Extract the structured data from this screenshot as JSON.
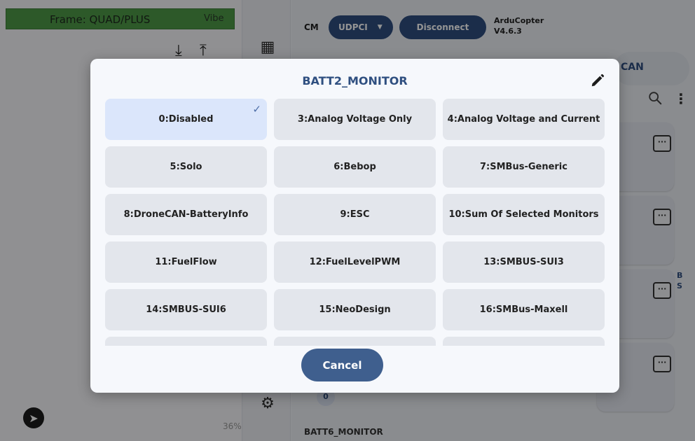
{
  "left": {
    "frame_label": "Frame: QUAD/PLUS",
    "vibe_label": "Vibe",
    "percent_text": "36%"
  },
  "connection": {
    "cm_label": "CM",
    "link_type": "UDPCI",
    "disconnect_label": "Disconnect",
    "vehicle_name": "ArduCopter",
    "vehicle_version": "V4.6.3"
  },
  "tabs": {
    "can_label": "CAN"
  },
  "params": {
    "side_letters": [
      "B",
      "S"
    ],
    "value_chip": "0",
    "batt6_label": "BATT6_MONITOR"
  },
  "dialog": {
    "title": "BATT2_MONITOR",
    "selected_index": 0,
    "options": [
      "0:Disabled",
      "3:Analog Voltage Only",
      "4:Analog Voltage and Current",
      "5:Solo",
      "6:Bebop",
      "7:SMBus-Generic",
      "8:DroneCAN-BatteryInfo",
      "9:ESC",
      "10:Sum Of Selected Monitors",
      "11:FuelFlow",
      "12:FuelLevelPWM",
      "13:SMBUS-SUI3",
      "14:SMBUS-SUI6",
      "15:NeoDesign",
      "16:SMBus-Maxell",
      "",
      "",
      ""
    ],
    "cancel_label": "Cancel"
  },
  "colors": {
    "accent": "#2f4f80",
    "selected_option": "#dbe6fb",
    "option_bg": "#e3e6ec",
    "frame_bar": "#4e9a48"
  }
}
